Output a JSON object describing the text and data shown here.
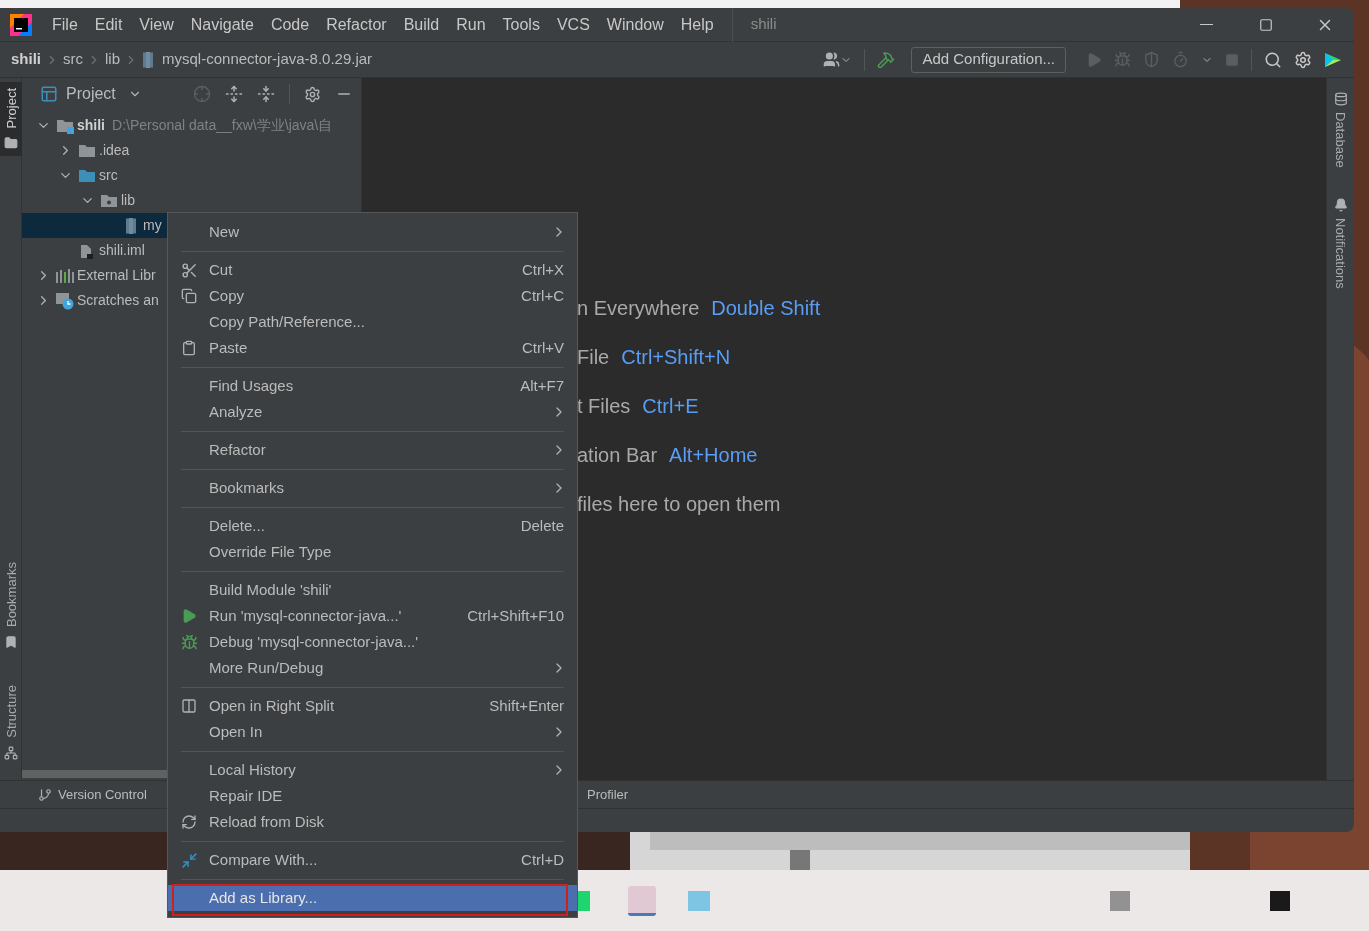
{
  "title_bar": {
    "menu": [
      {
        "label": "File"
      },
      {
        "label": "Edit"
      },
      {
        "label": "View"
      },
      {
        "label": "Navigate"
      },
      {
        "label": "Code"
      },
      {
        "label": "Refactor"
      },
      {
        "label": "Build"
      },
      {
        "label": "Run"
      },
      {
        "label": "Tools"
      },
      {
        "label": "VCS"
      },
      {
        "label": "Window"
      },
      {
        "label": "Help"
      }
    ],
    "title": "shili"
  },
  "breadcrumbs": [
    {
      "label": "shili",
      "kind": "module"
    },
    {
      "label": "src",
      "kind": "folder"
    },
    {
      "label": "lib",
      "kind": "folder"
    },
    {
      "label": "mysql-connector-java-8.0.29.jar",
      "kind": "jar"
    }
  ],
  "toolbar": {
    "run_configuration": "Add Configuration..."
  },
  "left_stripe": {
    "top": [
      {
        "label": "Project",
        "kind": "project",
        "selected": true
      }
    ],
    "bottom": [
      {
        "label": "Bookmarks",
        "kind": "bookmarks",
        "selected": false
      },
      {
        "label": "Structure",
        "kind": "structure",
        "selected": false
      }
    ]
  },
  "project_panel": {
    "title": "Project",
    "tree": [
      {
        "label": "shili",
        "kind": "module",
        "hint": "D:\\Personal data__fxw\\学业\\java\\自",
        "expanded": true,
        "selected": false,
        "children": [
          {
            "label": ".idea",
            "kind": "folder",
            "expanded": false,
            "selected": false
          },
          {
            "label": "src",
            "kind": "sources",
            "expanded": true,
            "selected": false,
            "children": [
              {
                "label": "lib",
                "kind": "libfolder",
                "expanded": true,
                "selected": false,
                "children": [
                  {
                    "label": "my",
                    "kind": "jar",
                    "selected": true
                  }
                ]
              }
            ]
          },
          {
            "label": "shili.iml",
            "kind": "iml",
            "selected": false
          }
        ]
      },
      {
        "label": "External Libr",
        "kind": "libraries",
        "expanded": false,
        "selected": false
      },
      {
        "label": "Scratches an",
        "kind": "scratches",
        "expanded": false,
        "selected": false
      }
    ]
  },
  "editor_hints": [
    {
      "text": "n Everywhere",
      "shortcut": "Double Shift"
    },
    {
      "text": "File",
      "shortcut": "Ctrl+Shift+N"
    },
    {
      "text": "t Files",
      "shortcut": "Ctrl+E"
    },
    {
      "text": "ation Bar",
      "shortcut": "Alt+Home"
    },
    {
      "text": "files here to open them"
    }
  ],
  "right_stripe": [
    {
      "label": "Database",
      "kind": "database"
    },
    {
      "label": "Notifications",
      "kind": "notifications"
    }
  ],
  "bottom_bar": [
    {
      "label": "Version Control"
    },
    {
      "label": "Profiler"
    }
  ],
  "context_menu": {
    "groups": [
      [
        {
          "label": "New",
          "submenu": true,
          "selected": false
        }
      ],
      [
        {
          "label": "Cut",
          "shortcut": "Ctrl+X",
          "submenu": false,
          "selected": false
        },
        {
          "label": "Copy",
          "shortcut": "Ctrl+C",
          "submenu": false,
          "selected": false
        },
        {
          "label": "Copy Path/Reference...",
          "submenu": false,
          "selected": false
        },
        {
          "label": "Paste",
          "shortcut": "Ctrl+V",
          "submenu": false,
          "selected": false
        }
      ],
      [
        {
          "label": "Find Usages",
          "shortcut": "Alt+F7",
          "submenu": false,
          "selected": false
        },
        {
          "label": "Analyze",
          "submenu": true,
          "selected": false
        }
      ],
      [
        {
          "label": "Refactor",
          "submenu": true,
          "selected": false
        }
      ],
      [
        {
          "label": "Bookmarks",
          "submenu": true,
          "selected": false
        }
      ],
      [
        {
          "label": "Delete...",
          "shortcut": "Delete",
          "submenu": false,
          "selected": false
        },
        {
          "label": "Override File Type",
          "submenu": false,
          "selected": false
        }
      ],
      [
        {
          "label": "Build Module 'shili'",
          "submenu": false,
          "selected": false
        },
        {
          "label": "Run 'mysql-connector-java...'",
          "shortcut": "Ctrl+Shift+F10",
          "submenu": false,
          "selected": false
        },
        {
          "label": "Debug 'mysql-connector-java...'",
          "submenu": false,
          "selected": false
        },
        {
          "label": "More Run/Debug",
          "submenu": true,
          "selected": false
        }
      ],
      [
        {
          "label": "Open in Right Split",
          "shortcut": "Shift+Enter",
          "submenu": false,
          "selected": false
        },
        {
          "label": "Open In",
          "submenu": true,
          "selected": false
        }
      ],
      [
        {
          "label": "Local History",
          "submenu": true,
          "selected": false
        },
        {
          "label": "Repair IDE",
          "submenu": false,
          "selected": false
        },
        {
          "label": "Reload from Disk",
          "submenu": false,
          "selected": false
        }
      ],
      [
        {
          "label": "Compare With...",
          "shortcut": "Ctrl+D",
          "submenu": false,
          "selected": false
        }
      ],
      [
        {
          "label": "Add as Library...",
          "submenu": false,
          "selected": true
        }
      ]
    ]
  }
}
